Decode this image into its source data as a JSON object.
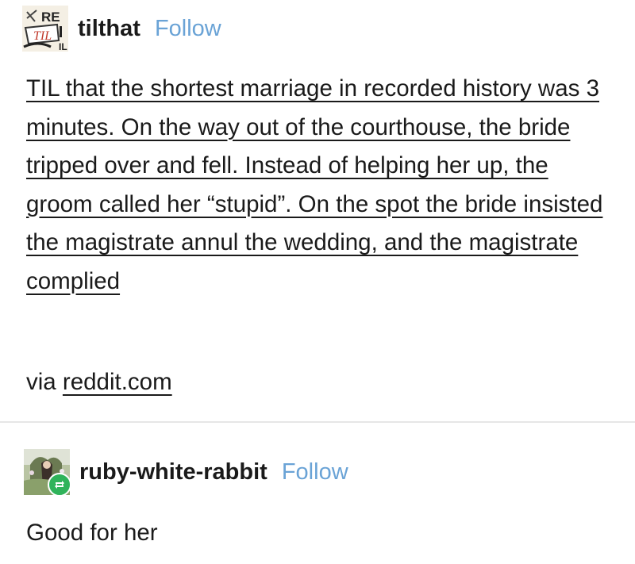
{
  "post": {
    "username": "tilthat",
    "follow_label": "Follow",
    "avatar_text": "TIL",
    "body": "TIL that the shortest marriage in recorded history was 3 minutes. On the way out of the courthouse, the bride tripped over and fell. Instead of helping her up, the groom called her “stupid”. On the spot the bride insisted the magistrate annul the wedding, and the magistrate complied",
    "via_prefix": "via",
    "via_link": "reddit.com"
  },
  "reblog": {
    "username": "ruby-white-rabbit",
    "follow_label": "Follow",
    "text": "Good for her"
  },
  "colors": {
    "follow": "#6aa3d6",
    "reblog_badge": "#2fb35a",
    "text": "#1a1a1a",
    "divider": "#e6e6e6"
  }
}
